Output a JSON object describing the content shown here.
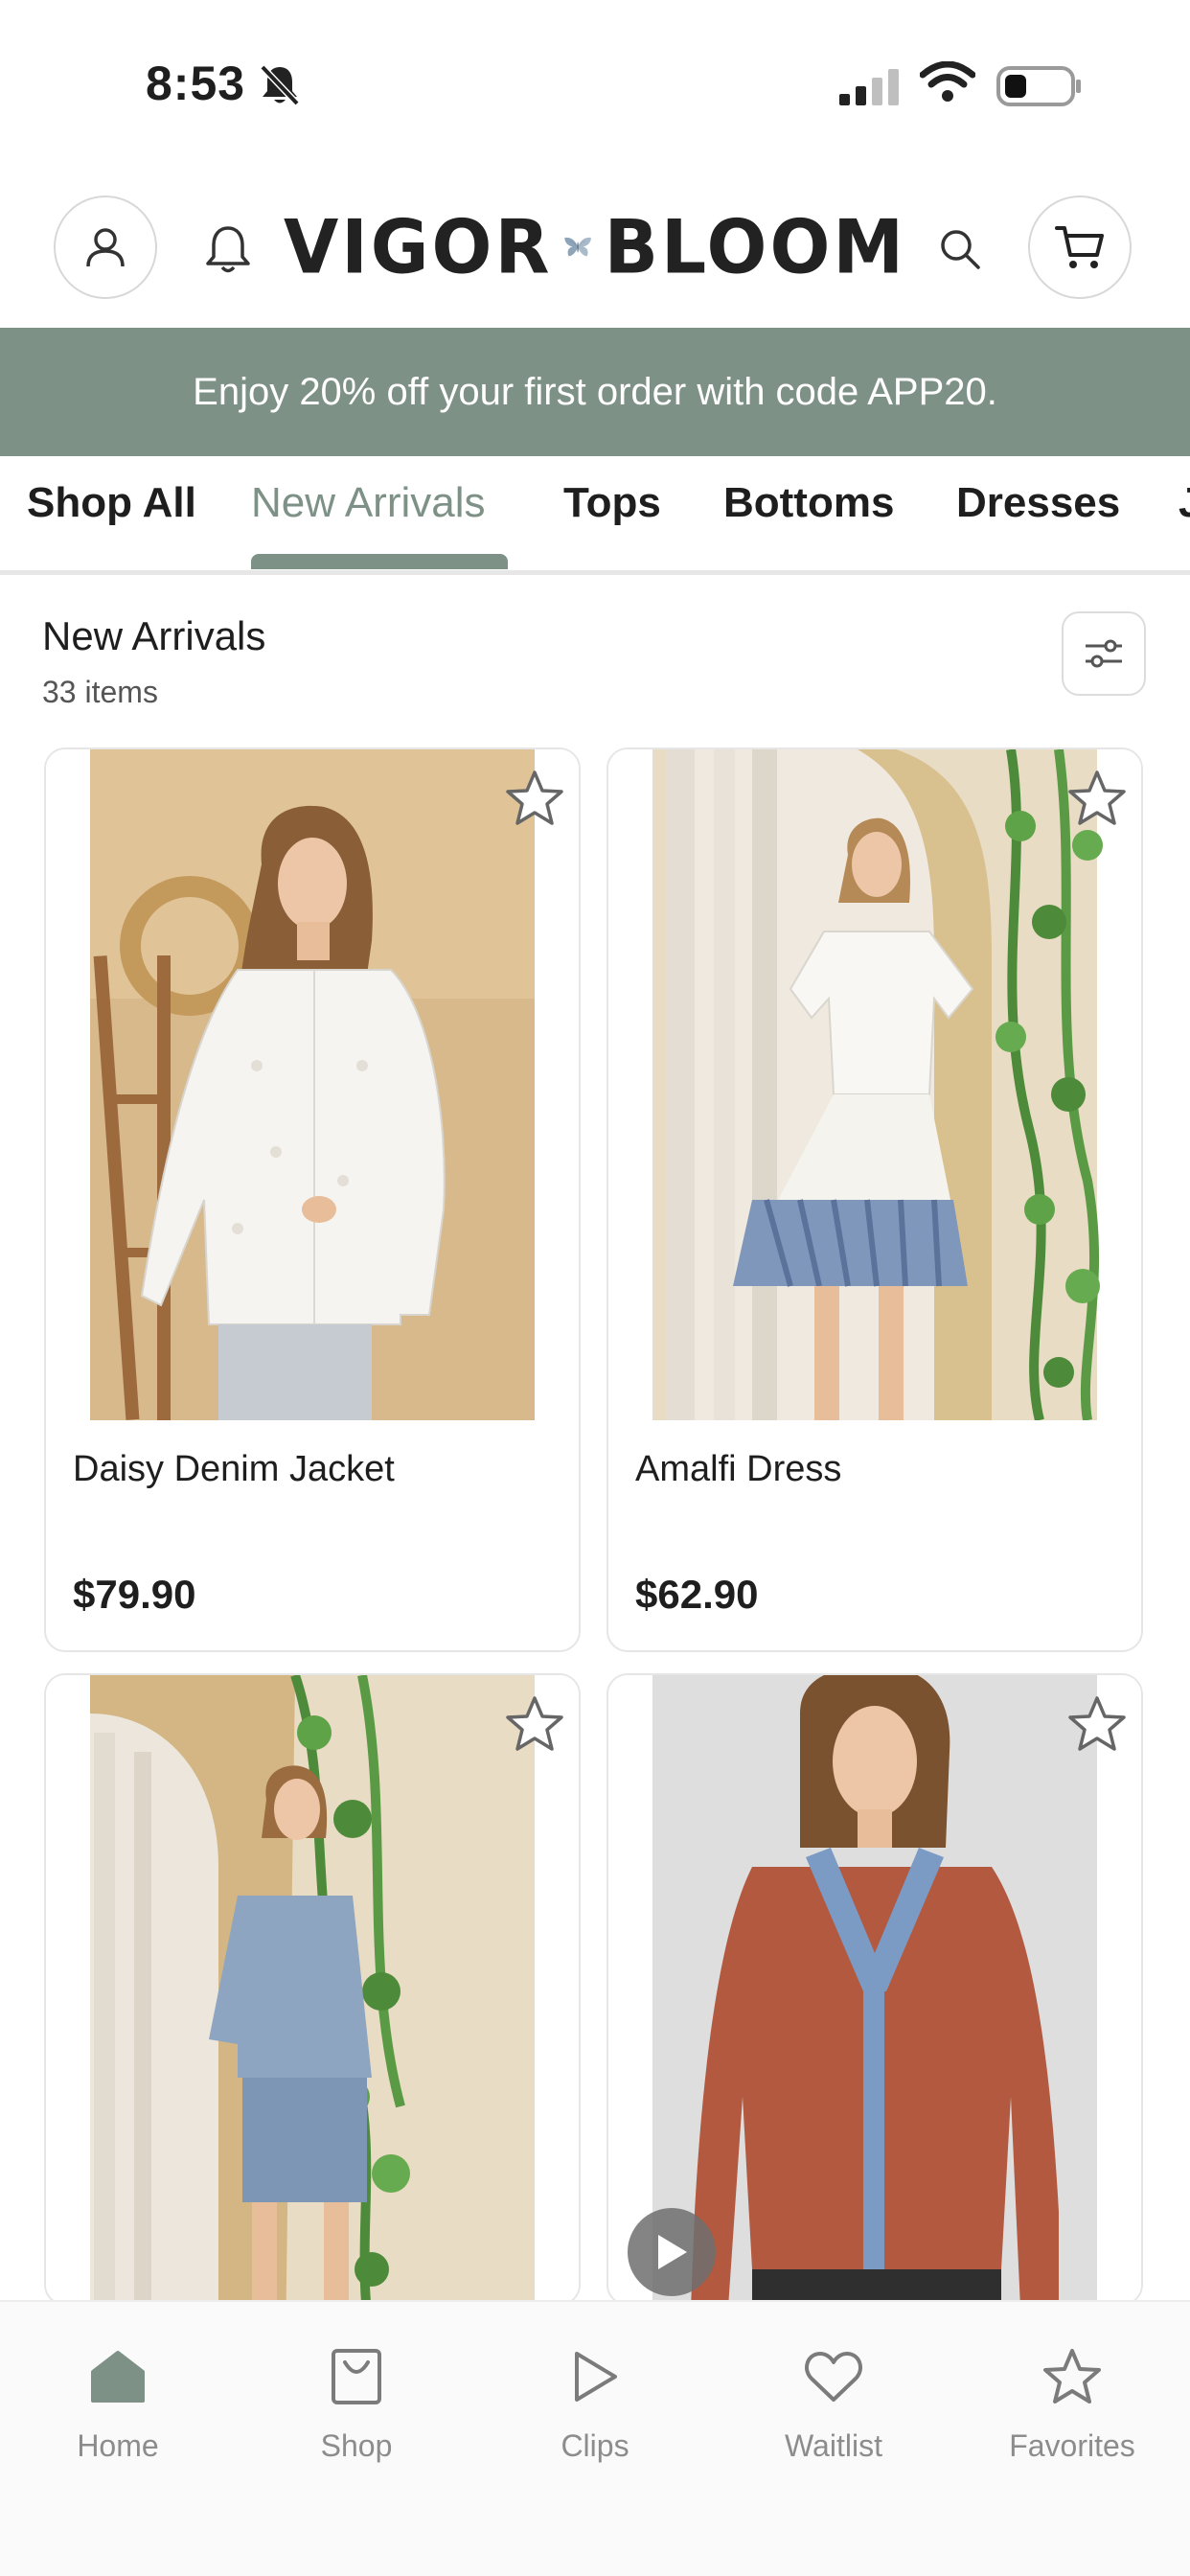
{
  "status_bar": {
    "time": "8:53"
  },
  "header": {
    "logo_left": "VIGOR",
    "logo_right": "BLOOM"
  },
  "promo": {
    "text": "Enjoy 20% off your first order with code APP20."
  },
  "tabs": [
    {
      "label": "Shop All"
    },
    {
      "label": "New Arrivals",
      "active": true
    },
    {
      "label": "Tops"
    },
    {
      "label": "Bottoms"
    },
    {
      "label": "Dresses"
    },
    {
      "label": "J"
    }
  ],
  "section": {
    "title": "New Arrivals",
    "count": "33 items"
  },
  "products": [
    {
      "name": "Daisy Denim Jacket",
      "price": "$79.90"
    },
    {
      "name": "Amalfi Dress",
      "price": "$62.90"
    },
    {
      "name": "",
      "price": ""
    },
    {
      "name": "",
      "price": ""
    }
  ],
  "bottom_nav": [
    {
      "label": "Home",
      "icon": "home-icon"
    },
    {
      "label": "Shop",
      "icon": "shopping-bag-icon"
    },
    {
      "label": "Clips",
      "icon": "play-outline-icon"
    },
    {
      "label": "Waitlist",
      "icon": "heart-icon"
    },
    {
      "label": "Favorites",
      "icon": "star-icon"
    }
  ],
  "colors": {
    "brand_sage": "#7e9186",
    "text_dark": "#1e1e1e",
    "nav_label": "#8c8c8c"
  }
}
